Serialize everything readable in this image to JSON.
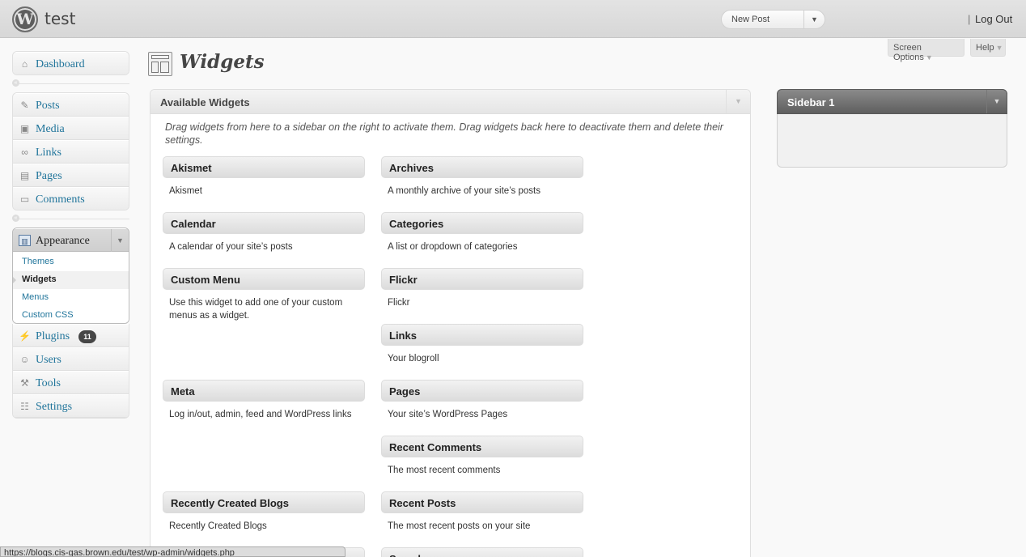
{
  "header": {
    "site_title": "test",
    "favorite_action": "New Post",
    "logout_separator": "|",
    "logout_label": "Log Out"
  },
  "screen_meta": {
    "screen_options": "Screen Options",
    "help": "Help"
  },
  "menu": {
    "dashboard": "Dashboard",
    "posts": "Posts",
    "media": "Media",
    "links": "Links",
    "pages": "Pages",
    "comments": "Comments",
    "appearance": "Appearance",
    "appearance_sub": [
      "Themes",
      "Widgets",
      "Menus",
      "Custom CSS"
    ],
    "appearance_current": "Widgets",
    "plugins": "Plugins",
    "plugins_badge": "11",
    "users": "Users",
    "tools": "Tools",
    "settings": "Settings"
  },
  "page": {
    "title": "Widgets"
  },
  "available": {
    "title": "Available Widgets",
    "description": "Drag widgets from here to a sidebar on the right to activate them. Drag widgets back here to deactivate them and delete their settings.",
    "widgets": [
      {
        "title": "Akismet",
        "desc": "Akismet"
      },
      {
        "title": "Archives",
        "desc": "A monthly archive of your site’s posts"
      },
      {
        "title": "Calendar",
        "desc": "A calendar of your site’s posts"
      },
      {
        "title": "Categories",
        "desc": "A list or dropdown of categories"
      },
      {
        "title": "Custom Menu",
        "desc": "Use this widget to add one of your custom menus as a widget."
      },
      {
        "title": "Flickr",
        "desc": "Flickr"
      },
      {
        "title": "Links",
        "desc": "Your blogroll"
      },
      {
        "title": "Meta",
        "desc": "Log in/out, admin, feed and WordPress links"
      },
      {
        "title": "Pages",
        "desc": "Your site’s WordPress Pages"
      },
      {
        "title": "Recent Comments",
        "desc": "The most recent comments"
      },
      {
        "title": "Recently Created Blogs",
        "desc": "Recently Created Blogs"
      },
      {
        "title": "Recent Posts",
        "desc": "The most recent posts on your site"
      },
      {
        "title": "Search",
        "desc": ""
      }
    ]
  },
  "sidebar": {
    "title": "Sidebar 1"
  },
  "statusbar": {
    "url": "https://blogs.cis-gas.brown.edu/test/wp-admin/widgets.php"
  },
  "icons": {
    "logo": "wordpress-logo-icon",
    "toggle": "arrow-down-icon"
  }
}
